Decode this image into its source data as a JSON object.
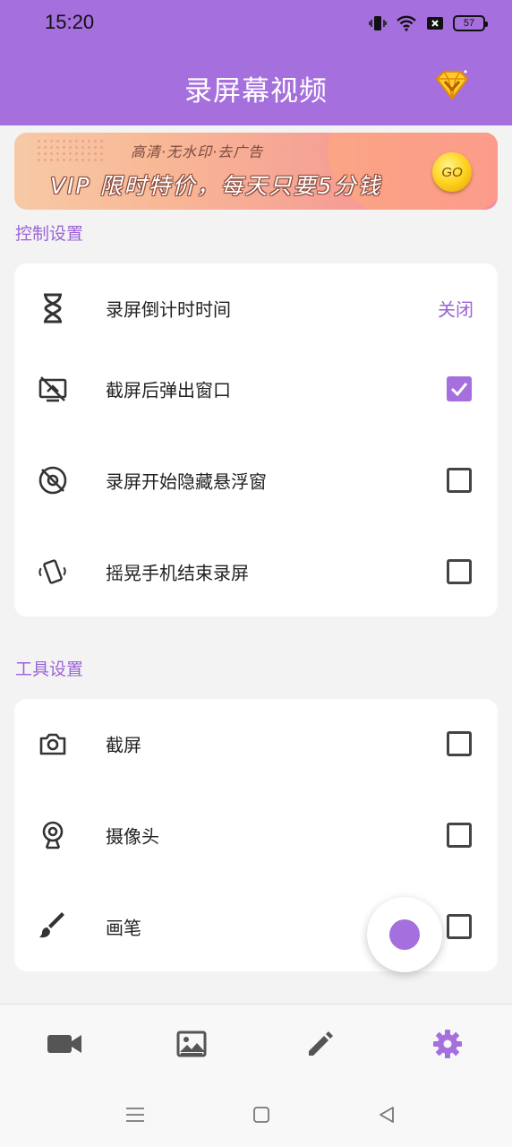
{
  "status_bar": {
    "time": "15:20",
    "battery": "57"
  },
  "header": {
    "title": "录屏幕视频"
  },
  "banner": {
    "subtitle": "高清·无水印·去广告",
    "headline": "VIP 限时特价，每天只要5分钱",
    "go_label": "GO"
  },
  "control_section": {
    "title": "控制设置",
    "items": [
      {
        "label": "录屏倒计时时间",
        "value": "关闭",
        "icon": "hourglass-icon"
      },
      {
        "label": "截屏后弹出窗口",
        "checked": true,
        "icon": "screenshot-off-icon"
      },
      {
        "label": "录屏开始隐藏悬浮窗",
        "checked": false,
        "icon": "hide-float-icon"
      },
      {
        "label": "摇晃手机结束录屏",
        "checked": false,
        "icon": "shake-phone-icon"
      }
    ]
  },
  "tool_section": {
    "title": "工具设置",
    "items": [
      {
        "label": "截屏",
        "checked": false,
        "icon": "camera-icon"
      },
      {
        "label": "摄像头",
        "checked": false,
        "icon": "webcam-icon"
      },
      {
        "label": "画笔",
        "checked": false,
        "icon": "brush-icon"
      }
    ]
  },
  "bottom_nav": {
    "items": [
      "video-icon",
      "gallery-icon",
      "edit-icon",
      "settings-icon"
    ],
    "active": "settings-icon"
  },
  "colors": {
    "accent": "#a56fde",
    "background": "#f3f3f3",
    "card": "#ffffff"
  }
}
